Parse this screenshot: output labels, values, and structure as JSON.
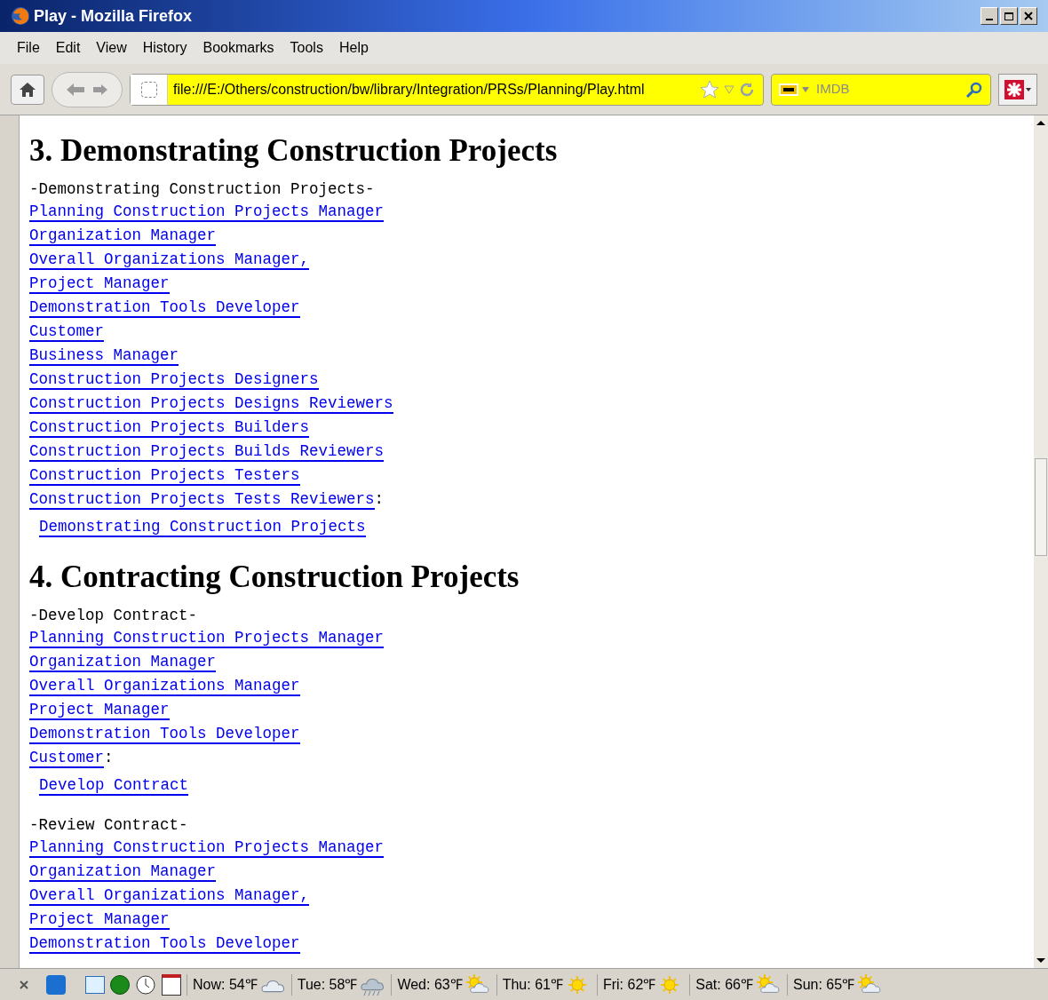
{
  "window": {
    "title": "Play - Mozilla Firefox"
  },
  "menu": [
    "File",
    "Edit",
    "View",
    "History",
    "Bookmarks",
    "Tools",
    "Help"
  ],
  "address_bar": {
    "value": "file:///E:/Others/construction/bw/library/Integration/PRSs/Planning/Play.html"
  },
  "search": {
    "placeholder": "IMDB"
  },
  "sections": [
    {
      "heading": "3. Demonstrating Construction Projects",
      "groups": [
        {
          "title": "-Demonstrating Construction Projects-",
          "links": [
            {
              "text": "Planning Construction Projects Manager"
            },
            {
              "text": "Organization Manager"
            },
            {
              "text": "Overall Organizations Manager,"
            },
            {
              "text": "Project Manager"
            },
            {
              "text": "Demonstration Tools Developer"
            },
            {
              "text": "Customer"
            },
            {
              "text": "Business Manager"
            },
            {
              "text": "Construction Projects Designers"
            },
            {
              "text": "Construction Projects Designs Reviewers"
            },
            {
              "text": "Construction Projects Builders"
            },
            {
              "text": "Construction Projects Builds Reviewers"
            },
            {
              "text": "Construction Projects Testers"
            },
            {
              "text": "Construction Projects Tests Reviewers",
              "suffix": ":"
            }
          ],
          "target": "Demonstrating Construction Projects"
        }
      ]
    },
    {
      "heading": "4. Contracting Construction Projects",
      "groups": [
        {
          "title": "-Develop Contract-",
          "links": [
            {
              "text": "Planning Construction Projects Manager"
            },
            {
              "text": "Organization Manager"
            },
            {
              "text": "Overall Organizations Manager"
            },
            {
              "text": "Project Manager"
            },
            {
              "text": "Demonstration Tools Developer"
            },
            {
              "text": "Customer",
              "suffix": ":"
            }
          ],
          "target": "Develop Contract"
        },
        {
          "title": "-Review Contract-",
          "links": [
            {
              "text": "Planning Construction Projects Manager"
            },
            {
              "text": "Organization Manager"
            },
            {
              "text": "Overall Organizations Manager,"
            },
            {
              "text": "Project Manager"
            },
            {
              "text": "Demonstration Tools Developer"
            }
          ]
        }
      ]
    }
  ],
  "status_bar": {
    "weather": [
      {
        "text": "Now: 54℉",
        "kind": "cloudy"
      },
      {
        "text": "Tue: 58℉",
        "kind": "rain"
      },
      {
        "text": "Wed: 63℉",
        "kind": "partly"
      },
      {
        "text": "Thu: 61℉",
        "kind": "sunny"
      },
      {
        "text": "Fri: 62℉",
        "kind": "sunny"
      },
      {
        "text": "Sat: 66℉",
        "kind": "partly"
      },
      {
        "text": "Sun: 65℉",
        "kind": "partly"
      }
    ]
  }
}
